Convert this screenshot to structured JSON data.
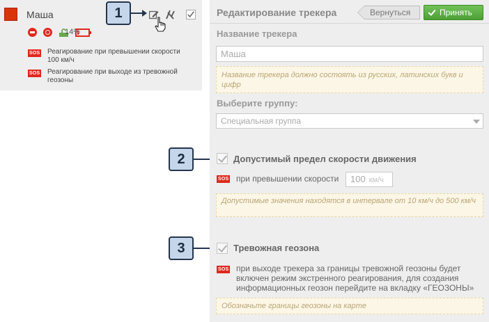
{
  "tracker_card": {
    "name": "Маша",
    "color": "#d9330c",
    "battery_percent": "14%",
    "alerts": [
      {
        "badge": "SOS",
        "text": "Реагирование при превышении скорости 100 км/ч"
      },
      {
        "badge": "SOS",
        "text": "Реагирование при выходе из тревожной геозоны"
      }
    ]
  },
  "callouts": [
    "1",
    "2",
    "3"
  ],
  "panel": {
    "title": "Редактирование трекера",
    "back_label": "Вернуться",
    "accept_label": "Принять",
    "name_label": "Название трекера",
    "name_value": "Маша",
    "name_hint": "Название трекера должно состоять из русских, латинских букв и цифр",
    "group_label": "Выберите группу:",
    "group_value": "Специальная группа",
    "speed": {
      "title": "Допустимый предел скорости движения",
      "badge": "SOS",
      "label": "при превышении скорости",
      "value": "100",
      "unit": "км/ч",
      "hint": "Допустимые значения находятся в интервале от 10 км/ч до 500 км/ч"
    },
    "geozone": {
      "title": "Тревожная геозона",
      "badge": "SOS",
      "text": "при выходе трекера за границы тревожной геозоны будет включен режим экстренного реагирования, для создания информационных геозон перейдите на вкладку «ГЕОЗОНЫ»",
      "hint": "Обозначьте границы геозоны на карте"
    }
  },
  "colors": {
    "accent_red": "#e0281e",
    "accept_green": "#5bb043",
    "callout_fill": "#c5d6ea",
    "callout_border": "#25354d"
  }
}
